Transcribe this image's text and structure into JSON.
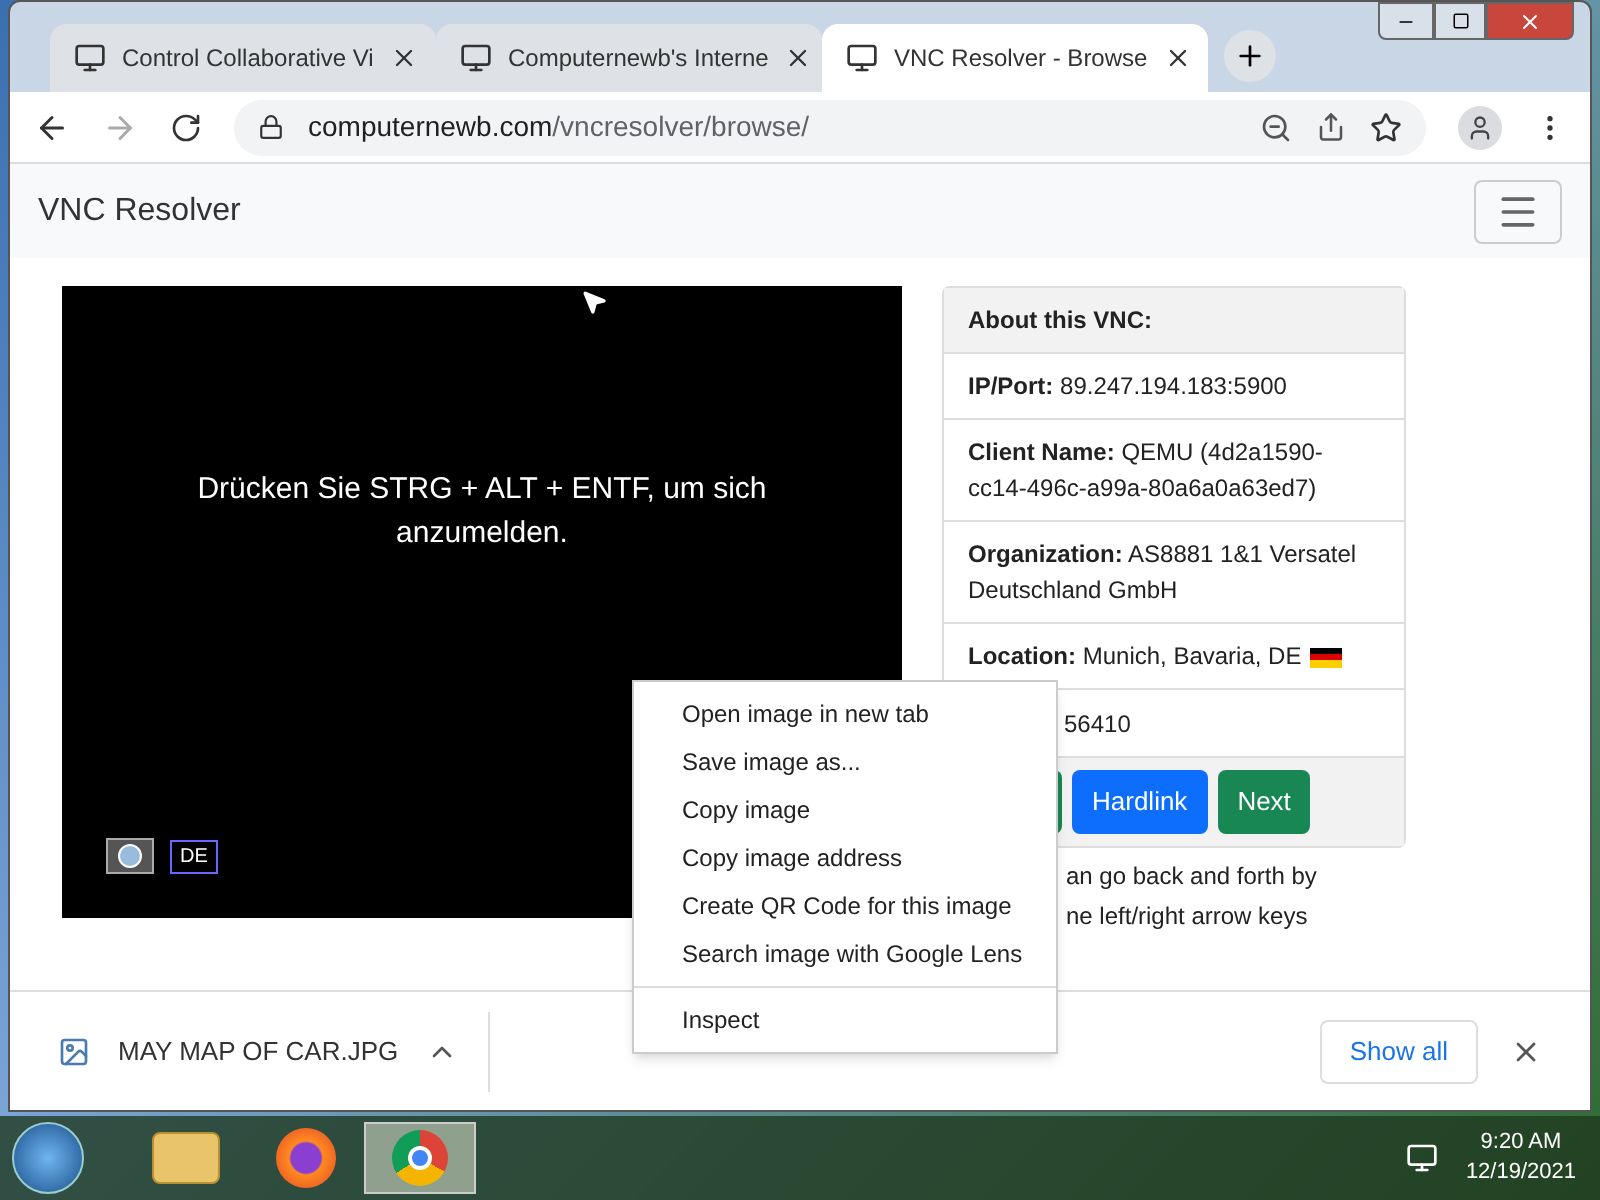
{
  "tabs": [
    {
      "title": "Control Collaborative Vi",
      "selected": false
    },
    {
      "title": "Computernewb's Interne",
      "selected": false
    },
    {
      "title": "VNC Resolver - Browse",
      "selected": true
    }
  ],
  "address": {
    "host": "computernewb.com",
    "path": "/vncresolver/browse/"
  },
  "site_title": "VNC Resolver",
  "vnc_screen": {
    "message": "Drücken Sie STRG + ALT + ENTF, um sich anzumelden.",
    "language": "DE"
  },
  "card": {
    "heading": "About this VNC:",
    "rows": [
      {
        "label": "IP/Port:",
        "value": "89.247.194.183:5900",
        "flag": false
      },
      {
        "label": "Client Name:",
        "value": "QEMU (4d2a1590-cc14-496c-a99a-80a6a0a63ed7)",
        "flag": false
      },
      {
        "label": "Organization:",
        "value": "AS8881 1&1 Versatel Deutschland GmbH",
        "flag": false
      },
      {
        "label": "Location:",
        "value": "Munich, Bavaria, DE",
        "flag": true
      }
    ],
    "partial_row": "56410",
    "buttons": [
      {
        "label": "Hardlink",
        "kind": "primary"
      },
      {
        "label": "Next",
        "kind": "success"
      }
    ]
  },
  "hint_lines": [
    "an go back and forth by",
    "ne left/right arrow keys"
  ],
  "context_menu": [
    [
      "Open image in new tab",
      "Save image as...",
      "Copy image",
      "Copy image address",
      "Create QR Code for this image",
      "Search image with Google Lens"
    ],
    [
      "Inspect"
    ]
  ],
  "download": {
    "file": "MAY MAP OF CAR.JPG",
    "show_all": "Show all"
  },
  "taskbar": {
    "time": "9:20 AM",
    "date": "12/19/2021"
  }
}
